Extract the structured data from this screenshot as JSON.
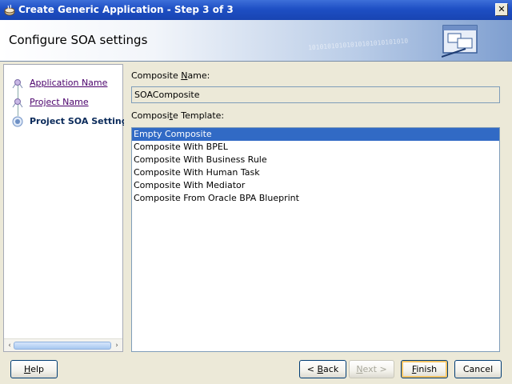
{
  "window": {
    "title": "Create Generic Application - Step 3 of 3",
    "close_label": "✕"
  },
  "header": {
    "title": "Configure SOA settings",
    "decor_text": "10101010101010101010101010"
  },
  "nav": {
    "items": [
      {
        "label": "Application Name",
        "state": "visited"
      },
      {
        "label": "Project Name",
        "state": "visited"
      },
      {
        "label": "Project SOA Settings",
        "state": "current"
      }
    ],
    "scroll_left": "‹",
    "scroll_right": "›"
  },
  "form": {
    "name_label_pre": "Composite ",
    "name_label_u": "N",
    "name_label_post": "ame:",
    "name_value": "SOAComposite",
    "template_label_pre": "Composi",
    "template_label_u": "t",
    "template_label_post": "e Template:",
    "templates": [
      "Empty Composite",
      "Composite With BPEL",
      "Composite With Business Rule",
      "Composite With Human Task",
      "Composite With Mediator",
      "Composite From Oracle BPA Blueprint"
    ],
    "selected_template_index": 0
  },
  "buttons": {
    "help_u": "H",
    "help_rest": "elp",
    "back_pre": "< ",
    "back_u": "B",
    "back_rest": "ack",
    "next_pre": "",
    "next_u": "N",
    "next_rest": "ext >",
    "finish_u": "F",
    "finish_rest": "inish",
    "cancel": "Cancel"
  },
  "colors": {
    "titlebar": "#1e4fc4",
    "selection": "#316ac5",
    "link": "#4a006b"
  }
}
